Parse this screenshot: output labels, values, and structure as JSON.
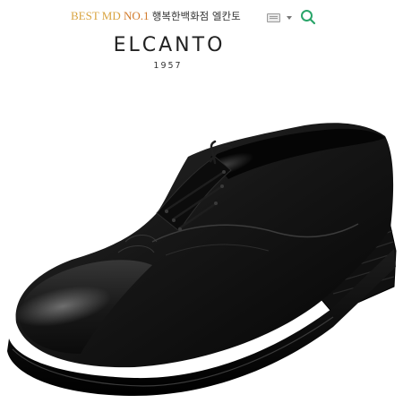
{
  "header": {
    "promo_best": "BEST MD",
    "promo_no1": "NO.1",
    "promo_tagline": "행복한백화점 엘칸토"
  },
  "toolbar": {
    "language_icon": "keyboard-icon",
    "dropdown_icon": "caret-down-icon",
    "search_icon": "search-icon"
  },
  "brand": {
    "name": "ELCANTO",
    "year": "1957"
  },
  "product": {
    "image": "black-leather-derby-shoe",
    "color": "#111111"
  },
  "colors": {
    "best": "#d9a441",
    "no1": "#d27a2b",
    "search": "#2aa56a"
  }
}
